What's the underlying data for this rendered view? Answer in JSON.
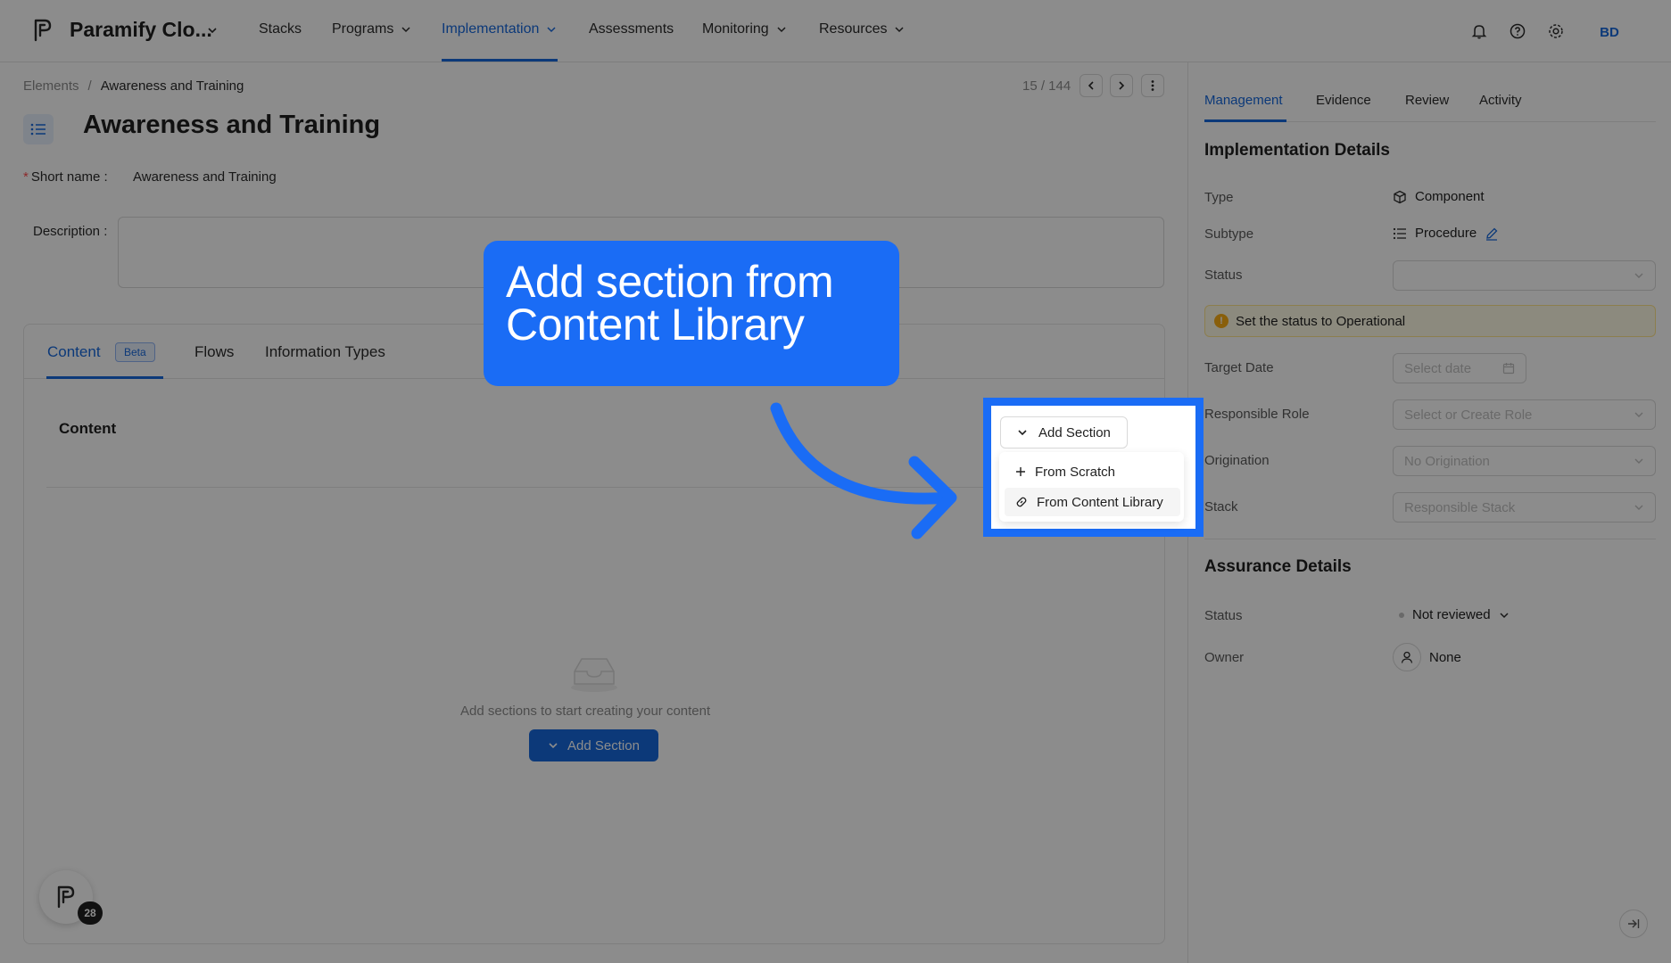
{
  "brand": {
    "name": "Paramify Clo..."
  },
  "nav": {
    "items": [
      {
        "label": "Stacks"
      },
      {
        "label": "Programs"
      },
      {
        "label": "Implementation"
      },
      {
        "label": "Assessments"
      },
      {
        "label": "Monitoring"
      },
      {
        "label": "Resources"
      }
    ],
    "active": "Implementation"
  },
  "user": {
    "initials": "BD"
  },
  "breadcrumb": {
    "parent": "Elements",
    "sep": "/",
    "current": "Awareness and Training"
  },
  "pager": {
    "text": "15 / 144"
  },
  "page": {
    "title": "Awareness and Training",
    "short_name_label": "Short name",
    "short_name_value": "Awareness and Training",
    "description_label": "Description"
  },
  "content_tabs": {
    "content": "Content",
    "beta": "Beta",
    "flows": "Flows",
    "info_types": "Information Types"
  },
  "content": {
    "heading": "Content",
    "empty_text": "Add sections to start creating your content",
    "add_section": "Add Section"
  },
  "helper": {
    "badge": "28"
  },
  "right_panel": {
    "tabs": [
      "Management",
      "Evidence",
      "Review",
      "Activity"
    ],
    "active_tab": "Management",
    "impl_heading": "Implementation Details",
    "type_label": "Type",
    "type_value": "Component",
    "subtype_label": "Subtype",
    "subtype_value": "Procedure",
    "status_label": "Status",
    "warning": "Set the status to Operational",
    "target_date_label": "Target Date",
    "target_date_placeholder": "Select date",
    "role_label": "Responsible Role",
    "role_placeholder": "Select or Create Role",
    "origination_label": "Origination",
    "origination_placeholder": "No Origination",
    "stack_label": "Stack",
    "stack_placeholder": "Responsible Stack",
    "assurance_heading": "Assurance Details",
    "assurance_status_label": "Status",
    "assurance_status_value": "Not reviewed",
    "owner_label": "Owner",
    "owner_value": "None"
  },
  "overlay": {
    "callout_line1": "Add section from",
    "callout_line2": "Content Library",
    "dropdown_button": "Add Section",
    "menu_items": [
      "From Scratch",
      "From Content Library"
    ]
  },
  "colors": {
    "accent": "#1668dc",
    "callout": "#1a6cf5",
    "warning_bg": "#fffbe6"
  }
}
